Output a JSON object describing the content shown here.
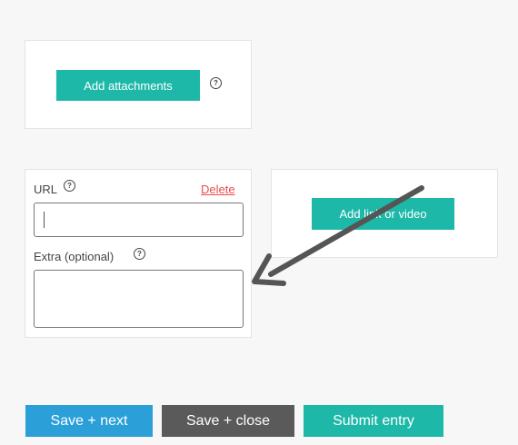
{
  "attachments": {
    "button_label": "Add attachments",
    "help_icon": "question-circle-icon"
  },
  "link_form": {
    "url_label": "URL",
    "delete_label": "Delete",
    "url_value": "",
    "extra_label": "Extra (optional)",
    "extra_value": "",
    "help_icon": "question-circle-icon"
  },
  "link_video": {
    "button_label": "Add link or video"
  },
  "annotation": {
    "arrow_icon": "arrow-icon",
    "color": "#555555"
  },
  "footer": {
    "save_next_label": "Save + next",
    "save_close_label": "Save + close",
    "submit_label": "Submit entry"
  },
  "colors": {
    "teal": "#1db8a8",
    "blue": "#2a9fd8",
    "gray": "#5a5a5a",
    "delete_red": "#e84c4c"
  }
}
